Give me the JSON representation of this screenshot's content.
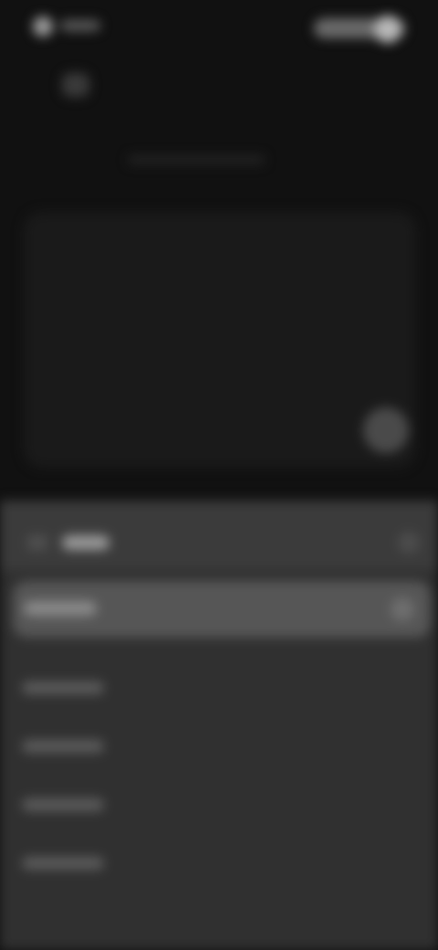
{
  "top_bar": {
    "left_icon": "circle-icon",
    "right_avatar_icon": "avatar-icon"
  },
  "nav": {
    "back_icon": "back-icon"
  },
  "card": {
    "fab_icon": "round-button-icon"
  },
  "sheet": {
    "back_icon": "back-icon",
    "more_icon": "more-icon",
    "selected_check_icon": "check-icon",
    "item_count": 4
  },
  "colors": {
    "background": "#111111",
    "sheet": "#303030",
    "selected_row": "#565656"
  }
}
